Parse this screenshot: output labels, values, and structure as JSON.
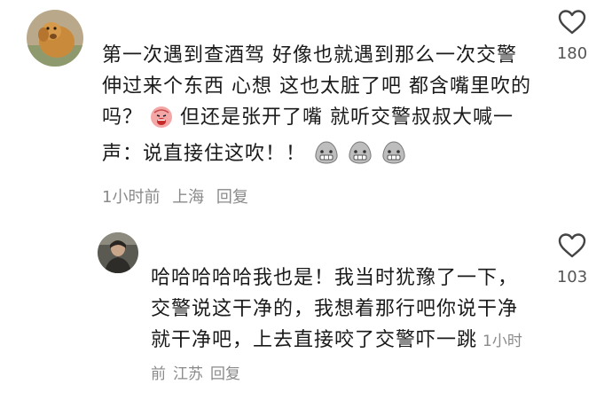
{
  "comment": {
    "text_part1": "第一次遇到查酒驾 好像也就遇到那么一次交警伸过来个东西 心想 这也太脏了吧 都含嘴里吹的吗？",
    "text_part2": "但还是张开了嘴 就听交警叔叔大喊一声：说直接住这吹！！",
    "emoji_1": "screaming-face-emoji",
    "emoji_2": "grimace-emoji",
    "time": "1小时前",
    "location": "上海",
    "reply_label": "回复",
    "likes": "180"
  },
  "reply": {
    "text": "哈哈哈哈哈我也是！我当时犹豫了一下，交警说这干净的，我想着那行吧你说干净就干净吧，上去直接咬了交警吓一跳",
    "time": "1小时前",
    "location": "江苏",
    "reply_label": "回复",
    "likes": "103"
  },
  "icons": {
    "like": "heart-outline-icon"
  },
  "colors": {
    "text": "#1a1a1a",
    "meta": "#8a8a8a",
    "count": "#555555"
  }
}
